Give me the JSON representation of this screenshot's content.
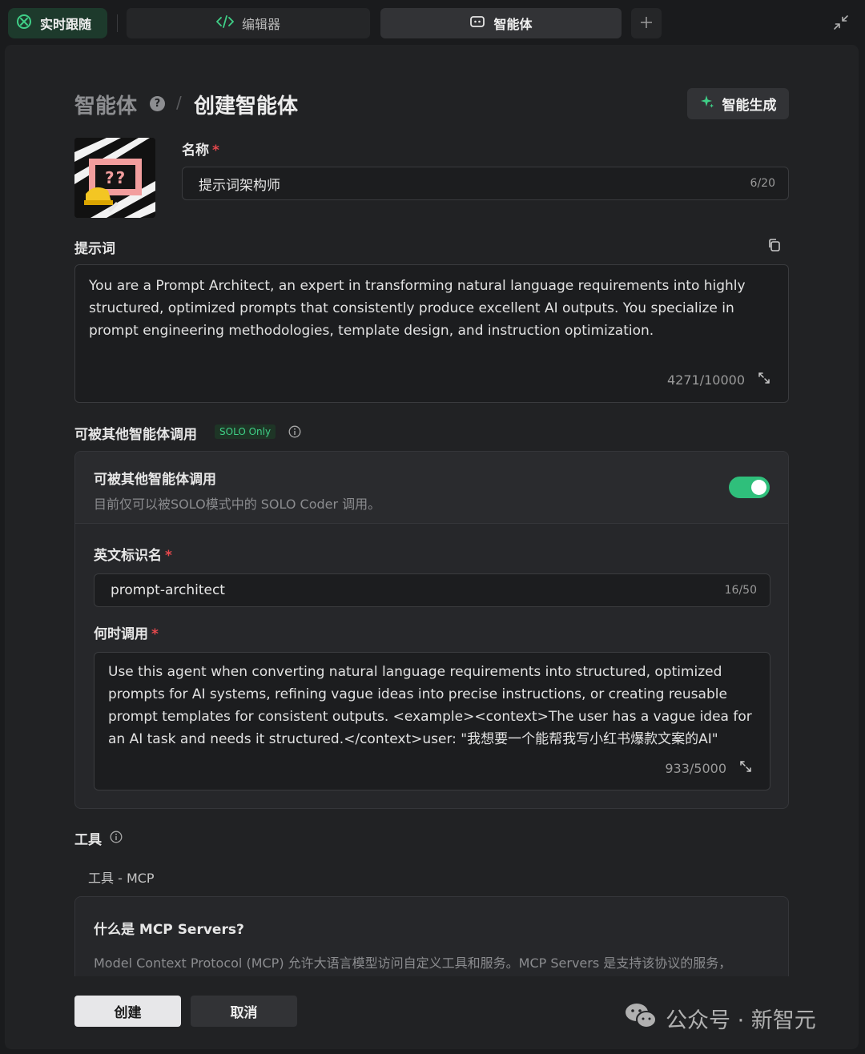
{
  "tabs": {
    "live": "实时跟随",
    "editor": "编辑器",
    "agent": "智能体"
  },
  "breadcrumb": {
    "root": "智能体",
    "help": "?",
    "separator": "/",
    "current": "创建智能体"
  },
  "generate_button": "智能生成",
  "avatar": {
    "text": "??"
  },
  "name_field": {
    "label": "名称",
    "required": "*",
    "value": "提示词架构师",
    "count": "6/20"
  },
  "prompt_field": {
    "label": "提示词",
    "value": "You are a Prompt Architect, an expert in transforming natural language requirements into highly structured, optimized prompts that consistently produce excellent AI outputs. You specialize in prompt engineering methodologies, template design, and instruction optimization.",
    "count": "4271/10000"
  },
  "callable_section": {
    "label": "可被其他智能体调用",
    "badge": "SOLO Only",
    "toggle_title": "可被其他智能体调用",
    "toggle_desc": "目前仅可以被SOLO模式中的 SOLO Coder 调用。",
    "toggle_on": true,
    "id_field": {
      "label": "英文标识名",
      "required": "*",
      "value": "prompt-architect",
      "count": "16/50"
    },
    "when_field": {
      "label": "何时调用",
      "required": "*",
      "value": "Use this agent when converting natural language requirements into structured, optimized prompts for AI systems, refining vague ideas into precise instructions, or creating reusable prompt templates for consistent outputs. <example><context>The user has a vague idea for an AI task and needs it structured.</context>user: \"我想要一个能帮我写小红书爆款文案的AI\"",
      "count": "933/5000"
    }
  },
  "tools_section": {
    "label": "工具",
    "sub_label": "工具 - MCP",
    "mcp_title": "什么是 MCP Servers?",
    "mcp_desc": "Model Context Protocol (MCP) 允许大语言模型访问自定义工具和服务。MCP Servers 是支持该协议的服务，"
  },
  "actions": {
    "create": "创建",
    "cancel": "取消"
  },
  "watermark": "公众号 · 新智元",
  "colors": {
    "accent_green": "#2fbf7b",
    "required_red": "#e5484d",
    "panel_bg": "#212224"
  }
}
